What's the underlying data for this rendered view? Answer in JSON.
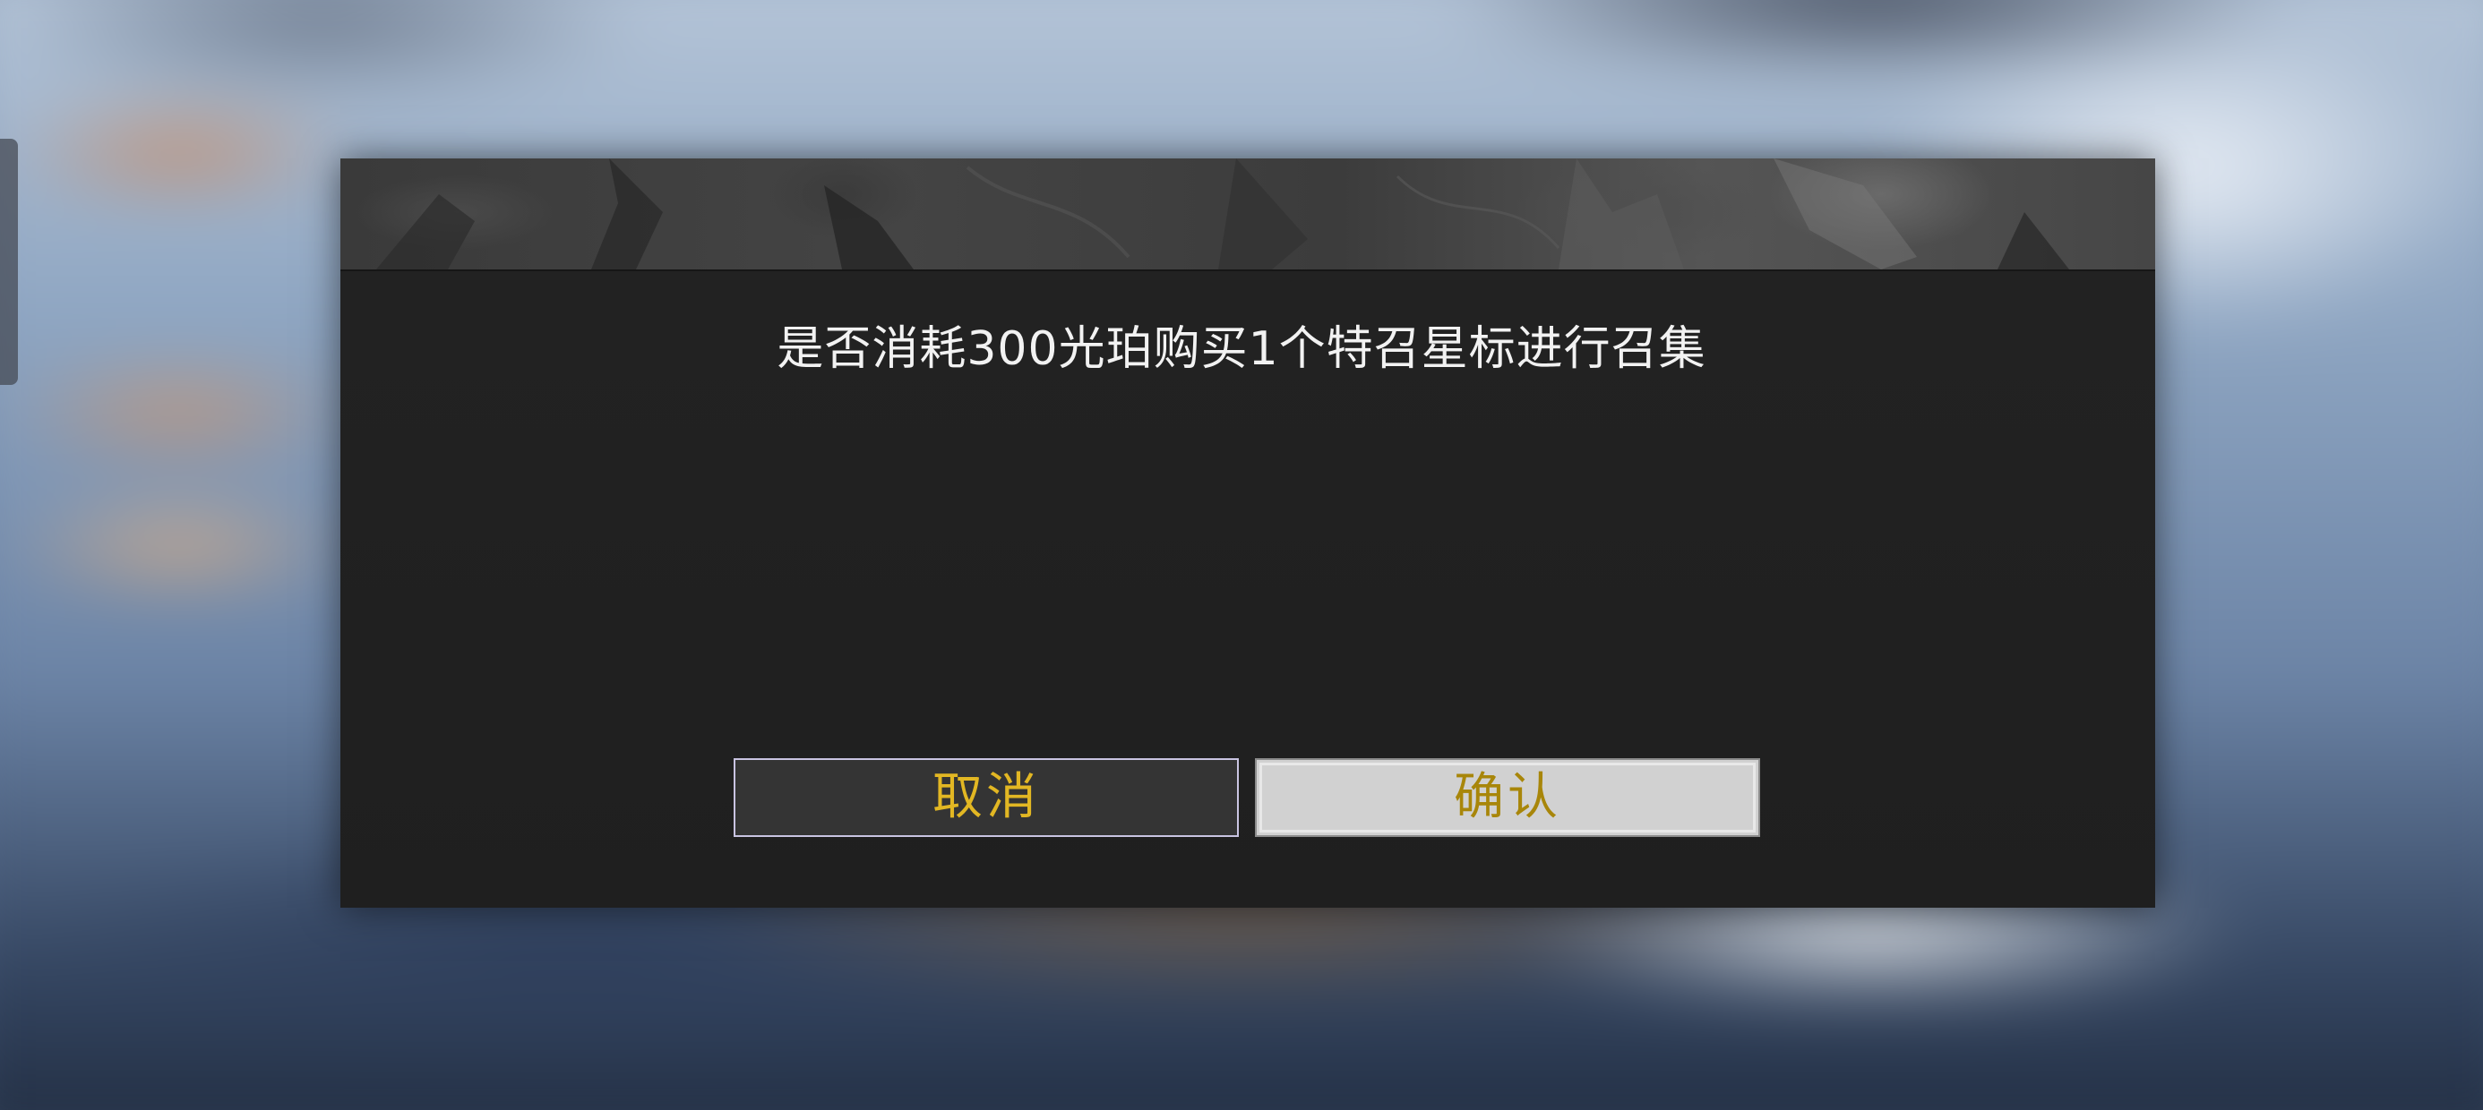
{
  "dialog": {
    "message": "是否消耗300光珀购买1个特召星标进行召集",
    "cancel_label": "取消",
    "confirm_label": "确认"
  },
  "colors": {
    "dialog_background": "#212121",
    "message_text": "#f2f2f2",
    "cancel_text": "#e2b723",
    "confirm_text": "#a8860a",
    "confirm_background": "#d1d1d1",
    "cancel_background": "#343434"
  }
}
